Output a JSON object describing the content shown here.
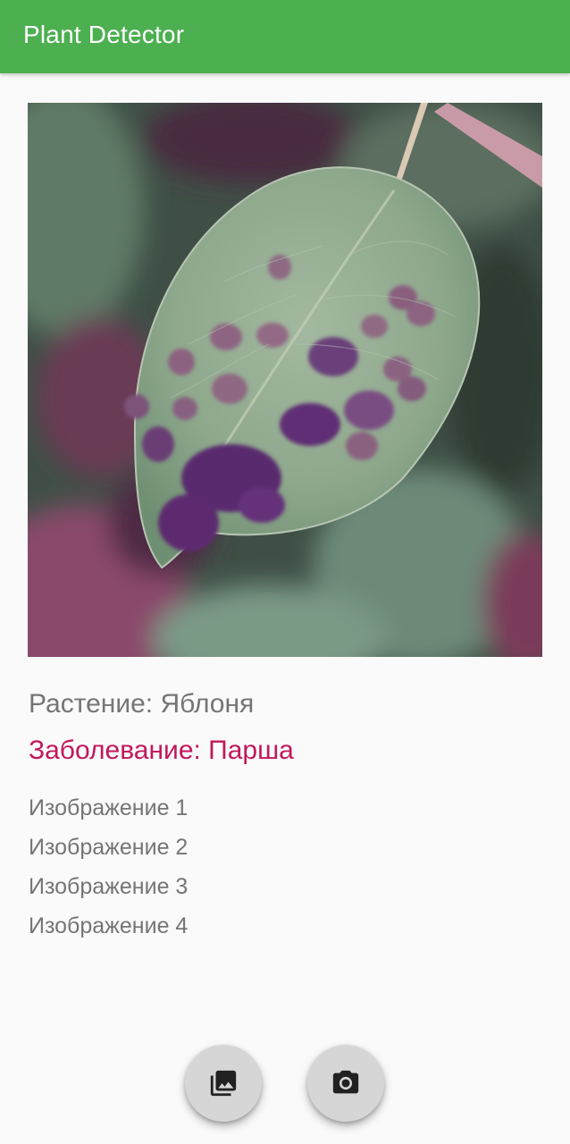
{
  "app_bar": {
    "title": "Plant Detector",
    "color": "#4caf50"
  },
  "result": {
    "plant_text": "Растение: Яблоня",
    "disease_text": "Заболевание: Парша",
    "disease_color": "#c2185b"
  },
  "images": [
    {
      "label": "Изображение 1"
    },
    {
      "label": "Изображение 2"
    },
    {
      "label": "Изображение 3"
    },
    {
      "label": "Изображение 4"
    }
  ],
  "fabs": {
    "gallery_icon": "photo-library-icon",
    "camera_icon": "camera-icon"
  }
}
